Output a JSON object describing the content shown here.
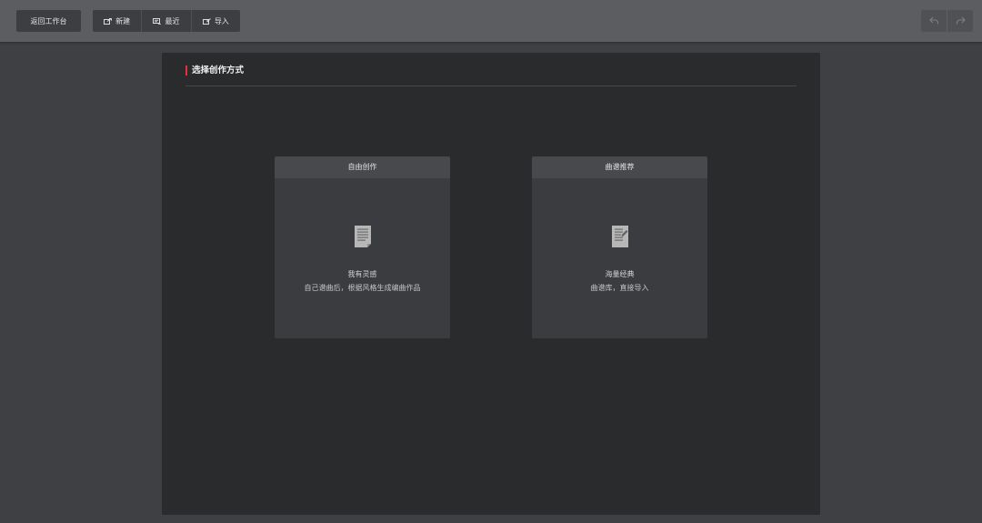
{
  "toolbar": {
    "back_label": "返回工作台",
    "new_label": "新建",
    "new_icon": "new-file-icon",
    "recent_label": "最近",
    "recent_icon": "recent-icon",
    "import_label": "导入",
    "import_icon": "import-icon",
    "undo_icon": "undo-icon",
    "redo_icon": "redo-icon"
  },
  "panel": {
    "title": "选择创作方式"
  },
  "cards": [
    {
      "header": "自由创作",
      "icon": "document-icon",
      "title": "我有灵感",
      "desc": "自己谱曲后，根据风格生成编曲作品"
    },
    {
      "header": "曲谱推荐",
      "icon": "score-edit-icon",
      "title": "海量经典",
      "desc": "曲谱库，直接导入"
    }
  ],
  "colors": {
    "accent": "#e0343a",
    "toolbar_bg": "#5c5d61",
    "page_bg": "#3f4044",
    "panel_bg": "#2a2b2d",
    "card_bg": "#3b3c40",
    "card_header_bg": "#48494d"
  }
}
